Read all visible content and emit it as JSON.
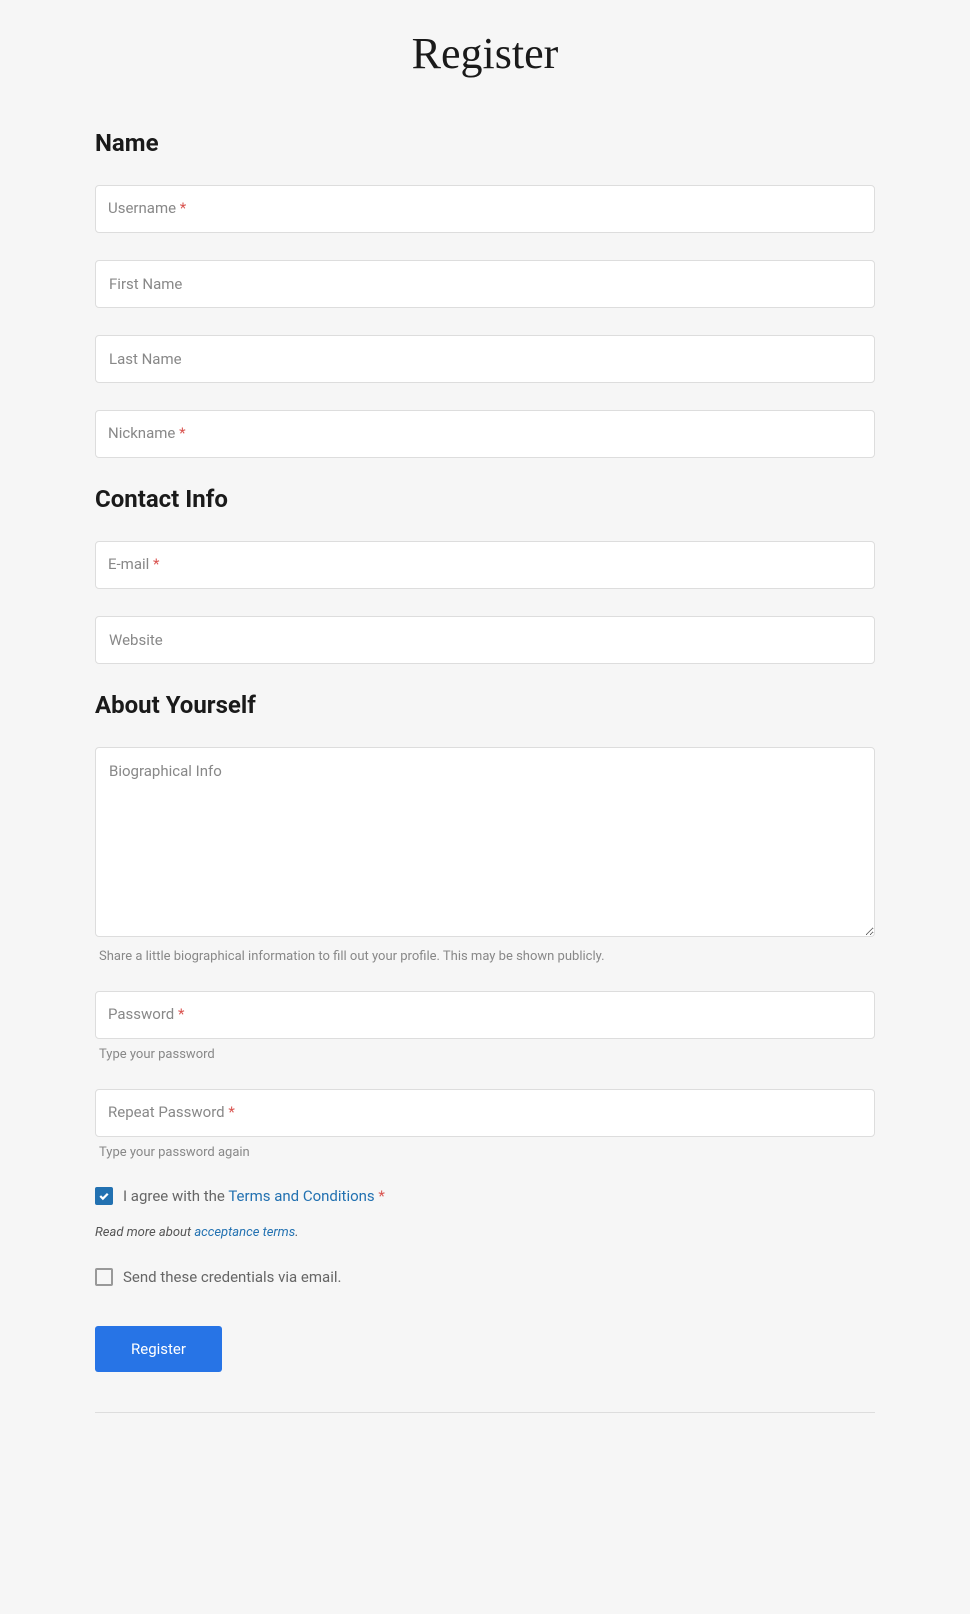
{
  "page": {
    "title": "Register"
  },
  "sections": {
    "name": {
      "heading": "Name",
      "fields": {
        "username": {
          "label": "Username",
          "required": true
        },
        "firstName": {
          "label": "First Name",
          "required": false
        },
        "lastName": {
          "label": "Last Name",
          "required": false
        },
        "nickname": {
          "label": "Nickname",
          "required": true
        }
      }
    },
    "contact": {
      "heading": "Contact Info",
      "fields": {
        "email": {
          "label": "E-mail",
          "required": true
        },
        "website": {
          "label": "Website",
          "required": false
        }
      }
    },
    "about": {
      "heading": "About Yourself",
      "fields": {
        "bio": {
          "label": "Biographical Info",
          "help": "Share a little biographical information to fill out your profile. This may be shown publicly."
        },
        "password": {
          "label": "Password",
          "required": true,
          "help": "Type your password"
        },
        "repeatPassword": {
          "label": "Repeat Password",
          "required": true,
          "help": "Type your password again"
        }
      }
    }
  },
  "agreements": {
    "terms": {
      "prefix": "I agree with the ",
      "link": "Terms and Conditions",
      "required": true,
      "checked": true,
      "notePrefix": "Read more about ",
      "noteLink": "acceptance terms",
      "noteSuffix": "."
    },
    "sendEmail": {
      "label": "Send these credentials via email.",
      "checked": false
    }
  },
  "submit": {
    "label": "Register"
  },
  "requiredMark": "*"
}
